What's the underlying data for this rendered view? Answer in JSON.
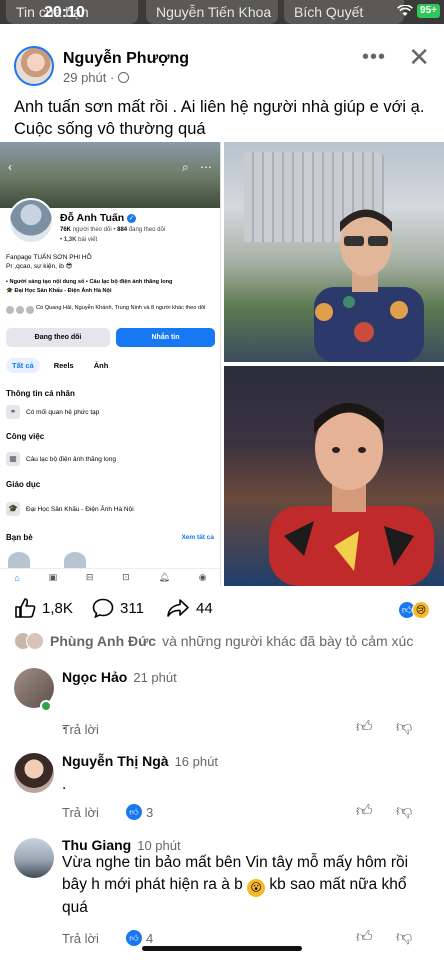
{
  "status_bar": {
    "time": "20:10",
    "battery": "95+",
    "story_chips": [
      "Tin của bạn",
      "Nguyễn Tiến Khoa",
      "Bích Quyết"
    ]
  },
  "post": {
    "author": "Nguyễn Phượng",
    "time": "29 phút ·",
    "text": "Anh tuấn sơn mất rồi . Ai liên hệ người nhà giúp e với ạ. Cuộc sống vô thường quá",
    "icons": {
      "more": "more-dots-icon",
      "close": "close-icon",
      "privacy": "globe-icon"
    }
  },
  "shared_profile": {
    "name": "Đỗ Anh Tuấn",
    "followers": "76K",
    "followers_label": "người theo dõi •",
    "following": "884",
    "following_label": "đang theo dõi",
    "posts": "1,3K",
    "posts_label": "bài viết",
    "bio_line1": "Fanpage  TUẤN SƠN PHI HỒ",
    "bio_line2": "Pr ,qcao, sự kiện, ib 😎",
    "tag1": "Người sáng tạo nội dung số",
    "tag2": "Câu lạc bộ điện ảnh thăng long",
    "tag3": "Đại Học Sân Khấu - Điện Ảnh Hà Nội",
    "mutual": "Có Quang Hải, Nguyễn Khánh, Trung Ninh và 8 người khác theo dõi",
    "follow_button": "Đang theo dõi",
    "message_button": "Nhắn tin",
    "tabs": [
      "Tất cả",
      "Reels",
      "Ảnh"
    ],
    "section_personal": "Thông tin cá nhân",
    "relationship": "Có mối quan hệ phức tạp",
    "section_work": "Công việc",
    "work_item": "Câu lạc bộ điện ảnh thăng long",
    "section_edu": "Giáo dục",
    "edu_item": "Đại Học Sân Khấu - Điện Ảnh Hà Nội",
    "section_friends": "Bạn bè",
    "see_all": "Xem tất cả"
  },
  "engagement": {
    "likes": "1,8K",
    "comments": "311",
    "shares": "44",
    "reacted_name": "Phùng Anh Đức",
    "reacted_suffix": "và những người khác đã bày tỏ cảm xúc"
  },
  "comments": [
    {
      "name": "Ngọc Hảo",
      "time": "21 phút",
      "text": ".",
      "reply": "Trả lời",
      "likes": ""
    },
    {
      "name": "Nguyễn Thị Ngà",
      "time": "16 phút",
      "text": ".",
      "reply": "Trả lời",
      "likes": "3"
    },
    {
      "name": "Thu Giang",
      "time": "10 phút",
      "text": "Vừa nghe tin bảo mất bên Vin tây mỗ mấy hôm rồi bây h mới phát hiện ra à b",
      "text_after": "kb sao mất nữa khổ quá",
      "reply": "Trả lời",
      "likes": "4"
    }
  ],
  "colors": {
    "brand": "#1877f2",
    "online": "#31a24c",
    "muted": "#65676b"
  }
}
